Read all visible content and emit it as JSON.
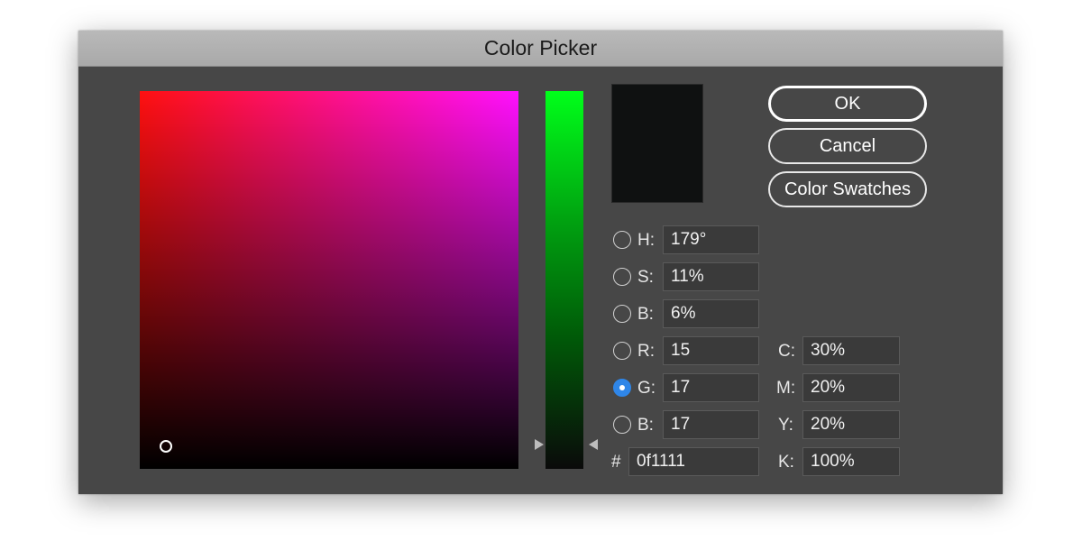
{
  "window": {
    "title": "Color Picker"
  },
  "colors": {
    "current_color": "#0f1111",
    "selected_radio": "#2f86e8",
    "dialog_bg": "#474747"
  },
  "buttons": {
    "ok": "OK",
    "cancel": "Cancel",
    "color_swatches": "Color Swatches"
  },
  "hsb": {
    "h_label": "H:",
    "h_value": "179°",
    "s_label": "S:",
    "s_value": "11%",
    "b_label": "B:",
    "b_value": "6%"
  },
  "rgb": {
    "r_label": "R:",
    "r_value": "15",
    "g_label": "G:",
    "g_value": "17",
    "b_label": "B:",
    "b_value": "17"
  },
  "hex": {
    "label": "#",
    "value": "0f1111"
  },
  "cmyk": {
    "c_label": "C:",
    "c_value": "30%",
    "m_label": "M:",
    "m_value": "20%",
    "y_label": "Y:",
    "y_value": "20%",
    "k_label": "K:",
    "k_value": "100%"
  },
  "selected_channel": "G"
}
